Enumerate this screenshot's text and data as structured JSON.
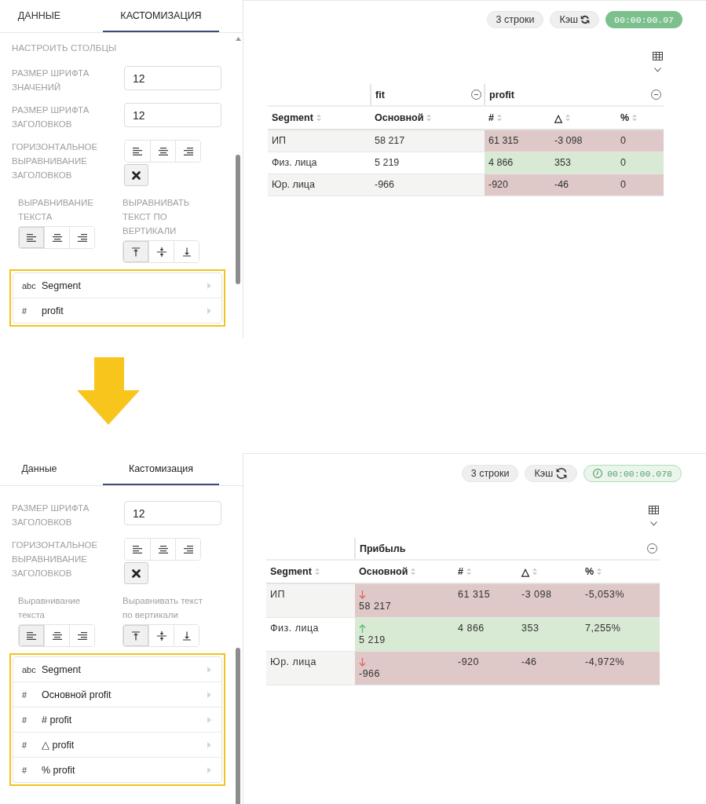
{
  "screenshots": [
    {
      "sidebar": {
        "tabs": [
          {
            "label": "ДАННЫЕ",
            "selected": false
          },
          {
            "label": "КАСТОМИЗАЦИЯ",
            "selected": true
          }
        ],
        "section_title": "НАСТРОИТЬ СТОЛБЦЫ",
        "settings": [
          {
            "kind": "number",
            "label": "РАЗМЕР ШРИФТА ЗНАЧЕНИЙ",
            "value": "12"
          },
          {
            "kind": "number",
            "label": "РАЗМЕР ШРИФТА ЗАГОЛОВКОВ",
            "value": "12"
          },
          {
            "kind": "alignment",
            "label": "ГОРИЗОНТАЛЬНОЕ ВЫРАВНИВАНИЕ ЗАГОЛОВКОВ",
            "options": [
              {
                "kind": "left",
                "selected": false
              },
              {
                "kind": "center",
                "selected": false
              },
              {
                "kind": "right",
                "selected": false
              }
            ]
          }
        ],
        "alignment_groups": [
          {
            "label": "ВЫРАВНИВАНИЕ ТЕКСТА",
            "options": [
              {
                "kind": "left",
                "selected": true
              },
              {
                "kind": "center",
                "selected": false
              },
              {
                "kind": "right",
                "selected": false
              }
            ]
          },
          {
            "label": "ВЫРАВНИВАТЬ ТЕКСТ ПО ВЕРТИКАЛИ",
            "options": [
              {
                "kind": "top",
                "selected": true
              },
              {
                "kind": "middle",
                "selected": false
              },
              {
                "kind": "bottom",
                "selected": false
              }
            ]
          }
        ],
        "columns": [
          {
            "type_label": "abc",
            "name": "Segment"
          },
          {
            "type_label": "#",
            "name": "profit"
          }
        ]
      },
      "main": {
        "badges": [
          {
            "kind": "rows",
            "label": "3 строки"
          },
          {
            "kind": "cache",
            "label": "Кэш"
          },
          {
            "kind": "timer",
            "label": "00:00:00.07"
          }
        ],
        "table": {
          "header_groups": [
            {
              "columns": [
                {
                  "label": "Segment"
                }
              ]
            },
            {
              "label": "fit",
              "columns": [
                {
                  "label": "Основной"
                }
              ]
            },
            {
              "label": "profit",
              "columns": [
                {
                  "label": "#"
                },
                {
                  "label": "△"
                },
                {
                  "label": "%"
                }
              ]
            }
          ],
          "rows": [
            {
              "negative": true,
              "cells": [
                {
                  "text": "ИП",
                  "highlighted": false,
                  "trend_arrow": false
                },
                {
                  "text": "58 217",
                  "highlighted": false,
                  "trend_arrow": false
                },
                {
                  "text": "61 315",
                  "highlighted": true,
                  "trend_arrow": false
                },
                {
                  "text": "-3 098",
                  "highlighted": true,
                  "trend_arrow": false
                },
                {
                  "text": "0",
                  "highlighted": true,
                  "trend_arrow": false
                }
              ]
            },
            {
              "negative": false,
              "cells": [
                {
                  "text": "Физ. лица",
                  "highlighted": false,
                  "trend_arrow": false
                },
                {
                  "text": "5 219",
                  "highlighted": false,
                  "trend_arrow": false
                },
                {
                  "text": "4 866",
                  "highlighted": true,
                  "trend_arrow": false
                },
                {
                  "text": "353",
                  "highlighted": true,
                  "trend_arrow": false
                },
                {
                  "text": "0",
                  "highlighted": true,
                  "trend_arrow": false
                }
              ]
            },
            {
              "negative": true,
              "cells": [
                {
                  "text": "Юр. лица",
                  "highlighted": false,
                  "trend_arrow": false
                },
                {
                  "text": "-966",
                  "highlighted": false,
                  "trend_arrow": false
                },
                {
                  "text": "-920",
                  "highlighted": true,
                  "trend_arrow": false
                },
                {
                  "text": "-46",
                  "highlighted": true,
                  "trend_arrow": false
                },
                {
                  "text": "0",
                  "highlighted": true,
                  "trend_arrow": false
                }
              ]
            }
          ]
        }
      }
    },
    {
      "sidebar": {
        "tabs": [
          {
            "label": "Данные",
            "selected": false
          },
          {
            "label": "Кастомизация",
            "selected": true
          }
        ],
        "settings": [
          {
            "kind": "number",
            "label": "РАЗМЕР ШРИФТА ЗАГОЛОВКОВ",
            "value": "12"
          },
          {
            "kind": "alignment",
            "label": "ГОРИЗОНТАЛЬНОЕ ВЫРАВНИВАНИЕ ЗАГОЛОВКОВ",
            "options": [
              {
                "kind": "left",
                "selected": false
              },
              {
                "kind": "center",
                "selected": false
              },
              {
                "kind": "right",
                "selected": false
              }
            ]
          }
        ],
        "alignment_groups": [
          {
            "label": "Выравнивание текста",
            "options": [
              {
                "kind": "left",
                "selected": true
              },
              {
                "kind": "center",
                "selected": false
              },
              {
                "kind": "right",
                "selected": false
              }
            ]
          },
          {
            "label": "Выравнивать текст по вертикали",
            "options": [
              {
                "kind": "top",
                "selected": true
              },
              {
                "kind": "middle",
                "selected": false
              },
              {
                "kind": "bottom",
                "selected": false
              }
            ]
          }
        ],
        "columns": [
          {
            "type_label": "abc",
            "name": "Segment"
          },
          {
            "type_label": "#",
            "name": "Основной profit"
          },
          {
            "type_label": "#",
            "name": "# profit"
          },
          {
            "type_label": "#",
            "name": "△ profit"
          },
          {
            "type_label": "#",
            "name": "% profit"
          }
        ]
      },
      "main": {
        "badges": [
          {
            "kind": "rows",
            "label": "3 строки"
          },
          {
            "kind": "cache",
            "label": "Кэш"
          },
          {
            "kind": "timer",
            "label": "00:00:00.078"
          }
        ],
        "table": {
          "header_groups": [
            {
              "columns": [
                {
                  "label": "Segment"
                }
              ]
            },
            {
              "label": "Прибыль",
              "columns": [
                {
                  "label": "Основной"
                },
                {
                  "label": "#"
                },
                {
                  "label": "△"
                },
                {
                  "label": "%"
                }
              ]
            }
          ],
          "rows": [
            {
              "negative": true,
              "cells": [
                {
                  "text": "ИП",
                  "highlighted": false,
                  "trend_arrow": false
                },
                {
                  "text": "58 217",
                  "highlighted": true,
                  "trend_arrow": true
                },
                {
                  "text": "61 315",
                  "highlighted": true,
                  "trend_arrow": false
                },
                {
                  "text": "-3 098",
                  "highlighted": true,
                  "trend_arrow": false
                },
                {
                  "text": "-5,053%",
                  "highlighted": true,
                  "trend_arrow": false
                }
              ]
            },
            {
              "negative": false,
              "cells": [
                {
                  "text": "Физ. лица",
                  "highlighted": false,
                  "trend_arrow": false
                },
                {
                  "text": "5 219",
                  "highlighted": true,
                  "trend_arrow": true
                },
                {
                  "text": "4 866",
                  "highlighted": true,
                  "trend_arrow": false
                },
                {
                  "text": "353",
                  "highlighted": true,
                  "trend_arrow": false
                },
                {
                  "text": "7,255%",
                  "highlighted": true,
                  "trend_arrow": false
                }
              ]
            },
            {
              "negative": true,
              "cells": [
                {
                  "text": "Юр. лица",
                  "highlighted": false,
                  "trend_arrow": false
                },
                {
                  "text": "-966",
                  "highlighted": true,
                  "trend_arrow": true
                },
                {
                  "text": "-920",
                  "highlighted": true,
                  "trend_arrow": false
                },
                {
                  "text": "-46",
                  "highlighted": true,
                  "trend_arrow": false
                },
                {
                  "text": "-4,972%",
                  "highlighted": true,
                  "trend_arrow": false
                }
              ]
            }
          ]
        }
      }
    }
  ]
}
